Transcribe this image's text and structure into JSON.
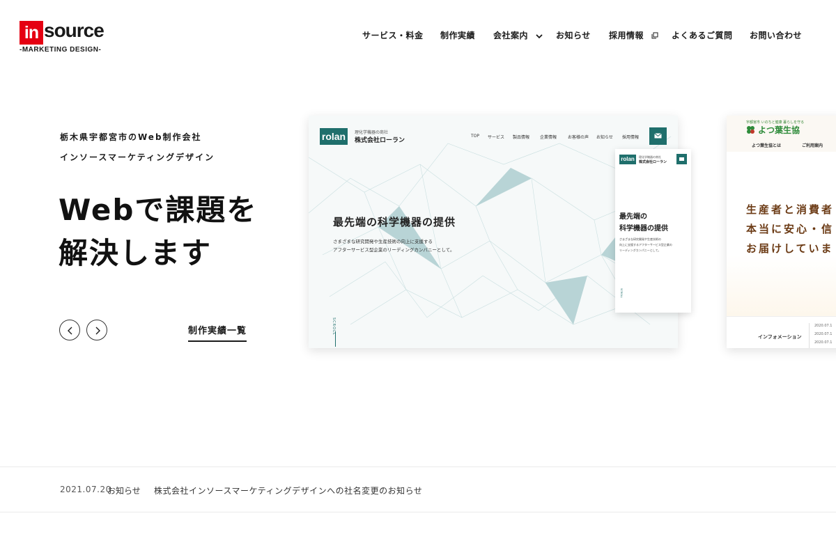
{
  "header": {
    "logo": {
      "in": "in",
      "rest": "source",
      "sub": "-MARKETING DESIGN-"
    },
    "nav": [
      {
        "label": "サービス・料金"
      },
      {
        "label": "制作実績"
      },
      {
        "label": "会社案内",
        "icon": "chevron-down-icon"
      },
      {
        "label": "お知らせ"
      },
      {
        "label": "採用情報",
        "icon": "external-link-icon"
      },
      {
        "label": "よくあるご質問"
      },
      {
        "label": "お問い合わせ"
      }
    ]
  },
  "hero": {
    "kicker1": "栃木県宇都宮市のWeb制作会社",
    "kicker2": "インソースマーケティングデザイン",
    "headline1": "Webで課題を",
    "headline2": "解決します",
    "prev_icon": "chevron-left-icon",
    "next_icon": "chevron-right-icon",
    "works_link": "制作実績一覧"
  },
  "slide1": {
    "logo": "rolan",
    "company_small": "理化学機器の商社",
    "company": "株式会社ローラン",
    "nav": [
      "TOP",
      "サービス",
      "製品情報",
      "企業情報",
      "お客様の声",
      "お知らせ",
      "採用情報"
    ],
    "title": "最先端の科学機器の提供",
    "desc1": "さまざまな研究開発や生産技術の向上に支援する",
    "desc2": "アフターサービス型企業のリーディングカンパニーとして。",
    "scroll": "SCROLL",
    "accent": "#1f6f6c",
    "phone": {
      "logo": "rolan",
      "company_small": "理化学機器の商社",
      "company": "株式会社ローラン",
      "title1": "最先端の",
      "title2": "科学機器の提供",
      "desc1": "さまざまな研究開発や生産技術の",
      "desc2": "向上に支援するアフターサービス型企業の",
      "desc3": "リーディングカンパニーとして。",
      "scroll": "SCROLL"
    }
  },
  "slide2": {
    "small": "宇都宮市 いのちと健康 暮らしを守る",
    "name": "よつ葉生協",
    "nav": [
      "よつ葉生協とは",
      "ご利用案内"
    ],
    "title1": "生産者と消費者",
    "title2": "本当に安心・信",
    "title3": "お届けしていま",
    "info_label": "インフォメーション",
    "dates": [
      "2020.07.1",
      "2020.07.1",
      "2020.07.1"
    ]
  },
  "news": {
    "date": "2021.07.20",
    "category": "お知らせ",
    "title": "株式会社インソースマーケティングデザインへの社名変更のお知らせ"
  }
}
